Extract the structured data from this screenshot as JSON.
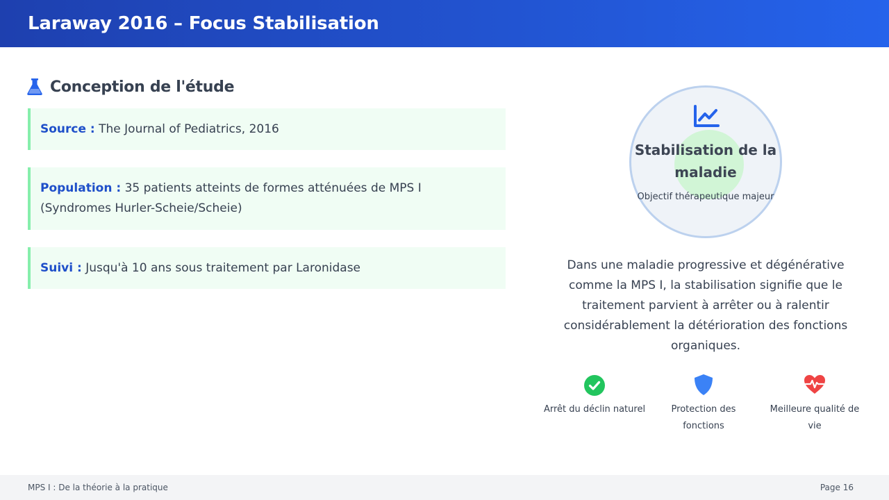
{
  "header": {
    "title": "Laraway 2016 – Focus Stabilisation"
  },
  "section": {
    "title": "Conception de l'étude",
    "icon": "flask-icon"
  },
  "cards": [
    {
      "label": "Source :",
      "text": " The Journal of Pediatrics, 2016"
    },
    {
      "label": "Population :",
      "text": " 35 patients atteints de formes atténuées de MPS I (Syndromes Hurler-Scheie/Scheie)"
    },
    {
      "label": "Suivi :",
      "text": " Jusqu'à 10 ans sous traitement par Laronidase"
    }
  ],
  "focus": {
    "icon": "line-chart-icon",
    "title": "Stabilisation de la maladie",
    "subtitle": "Objectif thérapeutique majeur"
  },
  "description": "Dans une maladie progressive et dégénérative comme la MPS I, la stabilisation signifie que le traitement parvient à arrêter ou à ralentir considérablement la détérioration des fonctions organiques.",
  "features": [
    {
      "icon": "check-circle-icon",
      "label": "Arrêt du déclin naturel",
      "color": "#22c55e"
    },
    {
      "icon": "shield-icon",
      "label": "Protection des fonctions",
      "color": "#3b82f6"
    },
    {
      "icon": "heart-pulse-icon",
      "label": "Meilleure qualité de vie",
      "color": "#ef4444"
    }
  ],
  "colors": {
    "header_start": "#1e40af",
    "header_end": "#2563eb",
    "label_blue": "#1e4fc9",
    "card_bg": "#f0fdf4",
    "card_border": "#86efac"
  },
  "footer": {
    "left": "MPS I : De la théorie à la pratique",
    "right": "Page 16"
  }
}
